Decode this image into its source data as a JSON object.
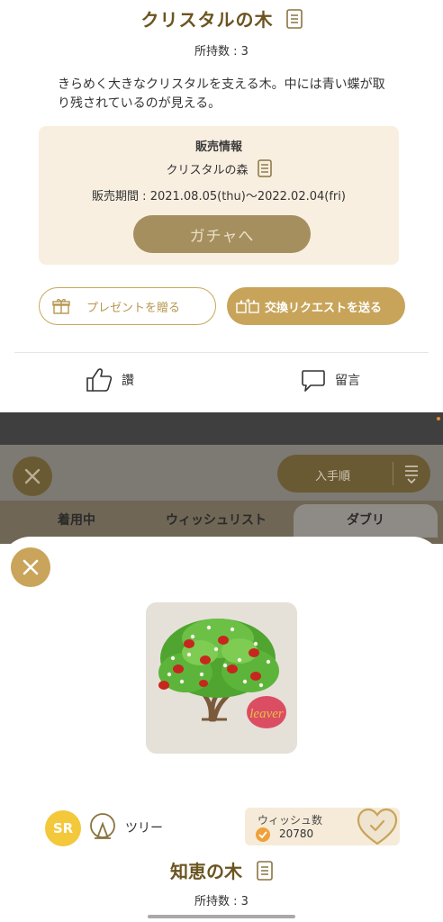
{
  "item": {
    "title": "クリスタルの木",
    "owned": "所持数 : 3",
    "description": "きらめく大きなクリスタルを支える木。中には青い蝶が取り残されているのが見える。"
  },
  "sales": {
    "heading": "販売情報",
    "shop": "クリスタルの森",
    "period": "販売期間 : 2021.08.05(thu)〜2022.02.04(fri)",
    "gacha_button": "ガチャへ"
  },
  "actions": {
    "present": "プレゼントを贈る",
    "trade": "交換リクエストを送る",
    "like": "讚",
    "comment": "留言"
  },
  "background": {
    "sort_label": "入手順",
    "tabs": [
      "着用中",
      "ウィッシュリスト",
      "ダブリ"
    ]
  },
  "sheet": {
    "rarity": "SR",
    "category": "ツリー",
    "wish_label": "ウィッシュ数",
    "wish_count": "20780",
    "title": "知恵の木",
    "owned": "所持数 : 3",
    "thumb_overlay": "leaver"
  },
  "colors": {
    "gold": "#c9a45a",
    "title_brown": "#6b5420",
    "sales_bg": "#f8efe1",
    "rarity_yellow": "#f3c83a"
  }
}
